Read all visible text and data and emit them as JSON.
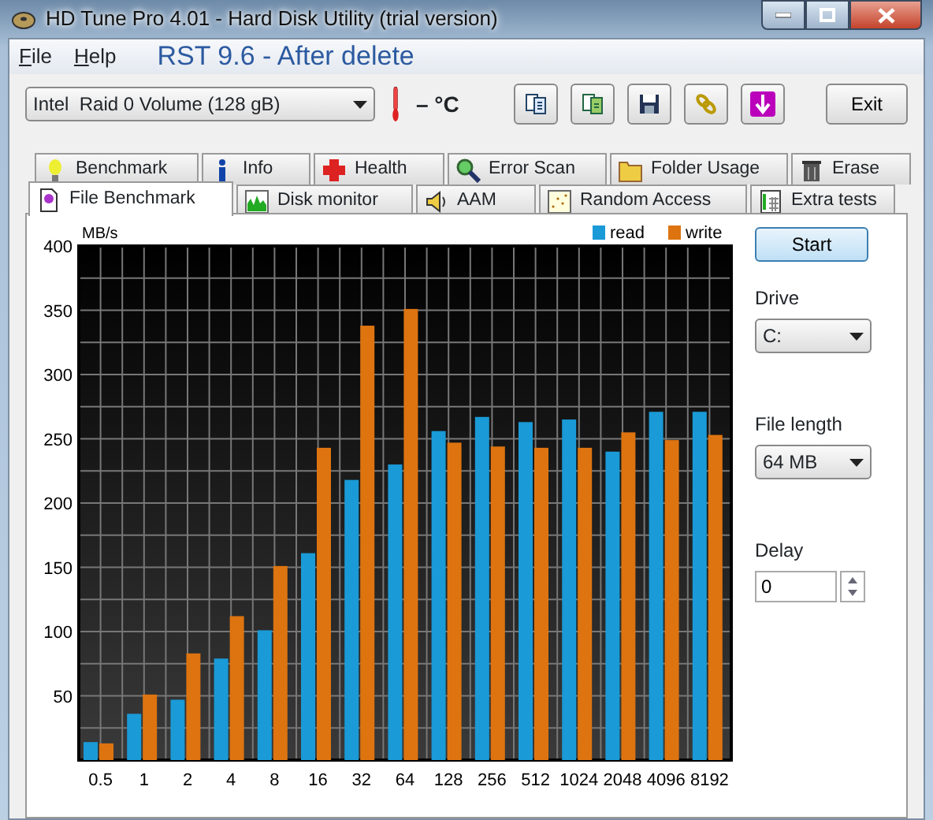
{
  "window": {
    "title": "HD Tune Pro 4.01 - Hard Disk Utility (trial version)"
  },
  "menu": [
    {
      "label": "File"
    },
    {
      "label": "Help"
    }
  ],
  "overlay_caption": "RST 9.6 - After delete",
  "toolbar": {
    "disk": "Intel  Raid 0 Volume (128 gB)",
    "temperature": "– °C",
    "exit": "Exit"
  },
  "tabs_top": [
    {
      "label": "Benchmark",
      "selected": false
    },
    {
      "label": "Info",
      "selected": false
    },
    {
      "label": "Health",
      "selected": false
    },
    {
      "label": "Error Scan",
      "selected": false
    },
    {
      "label": "Folder Usage",
      "selected": false
    },
    {
      "label": "Erase",
      "selected": false
    }
  ],
  "tabs_bottom": [
    {
      "label": "File Benchmark",
      "selected": true
    },
    {
      "label": "Disk monitor",
      "selected": false
    },
    {
      "label": "AAM",
      "selected": false
    },
    {
      "label": "Random Access",
      "selected": false
    },
    {
      "label": "Extra tests",
      "selected": false
    }
  ],
  "chart_data": {
    "type": "bar",
    "ylabel": "MB/s",
    "categories": [
      "0.5",
      "1",
      "2",
      "4",
      "8",
      "16",
      "32",
      "64",
      "128",
      "256",
      "512",
      "1024",
      "2048",
      "4096",
      "8192"
    ],
    "series": [
      {
        "name": "read",
        "color": "#1a9ad6",
        "values": [
          14,
          36,
          47,
          79,
          101,
          161,
          218,
          230,
          256,
          267,
          263,
          265,
          240,
          271,
          271
        ]
      },
      {
        "name": "write",
        "color": "#dd7410",
        "values": [
          13,
          51,
          83,
          112,
          151,
          243,
          338,
          351,
          247,
          244,
          243,
          243,
          255,
          249,
          253
        ]
      }
    ],
    "ylim": [
      0,
      400
    ],
    "grid": true,
    "legend": true,
    "yticks": [
      50,
      100,
      150,
      200,
      250,
      300,
      350,
      400
    ]
  },
  "side_panel": {
    "start": "Start",
    "drive_label": "Drive",
    "drive": "C:",
    "file_length_label": "File length",
    "file_length": "64 MB",
    "delay_label": "Delay",
    "delay": "0"
  }
}
